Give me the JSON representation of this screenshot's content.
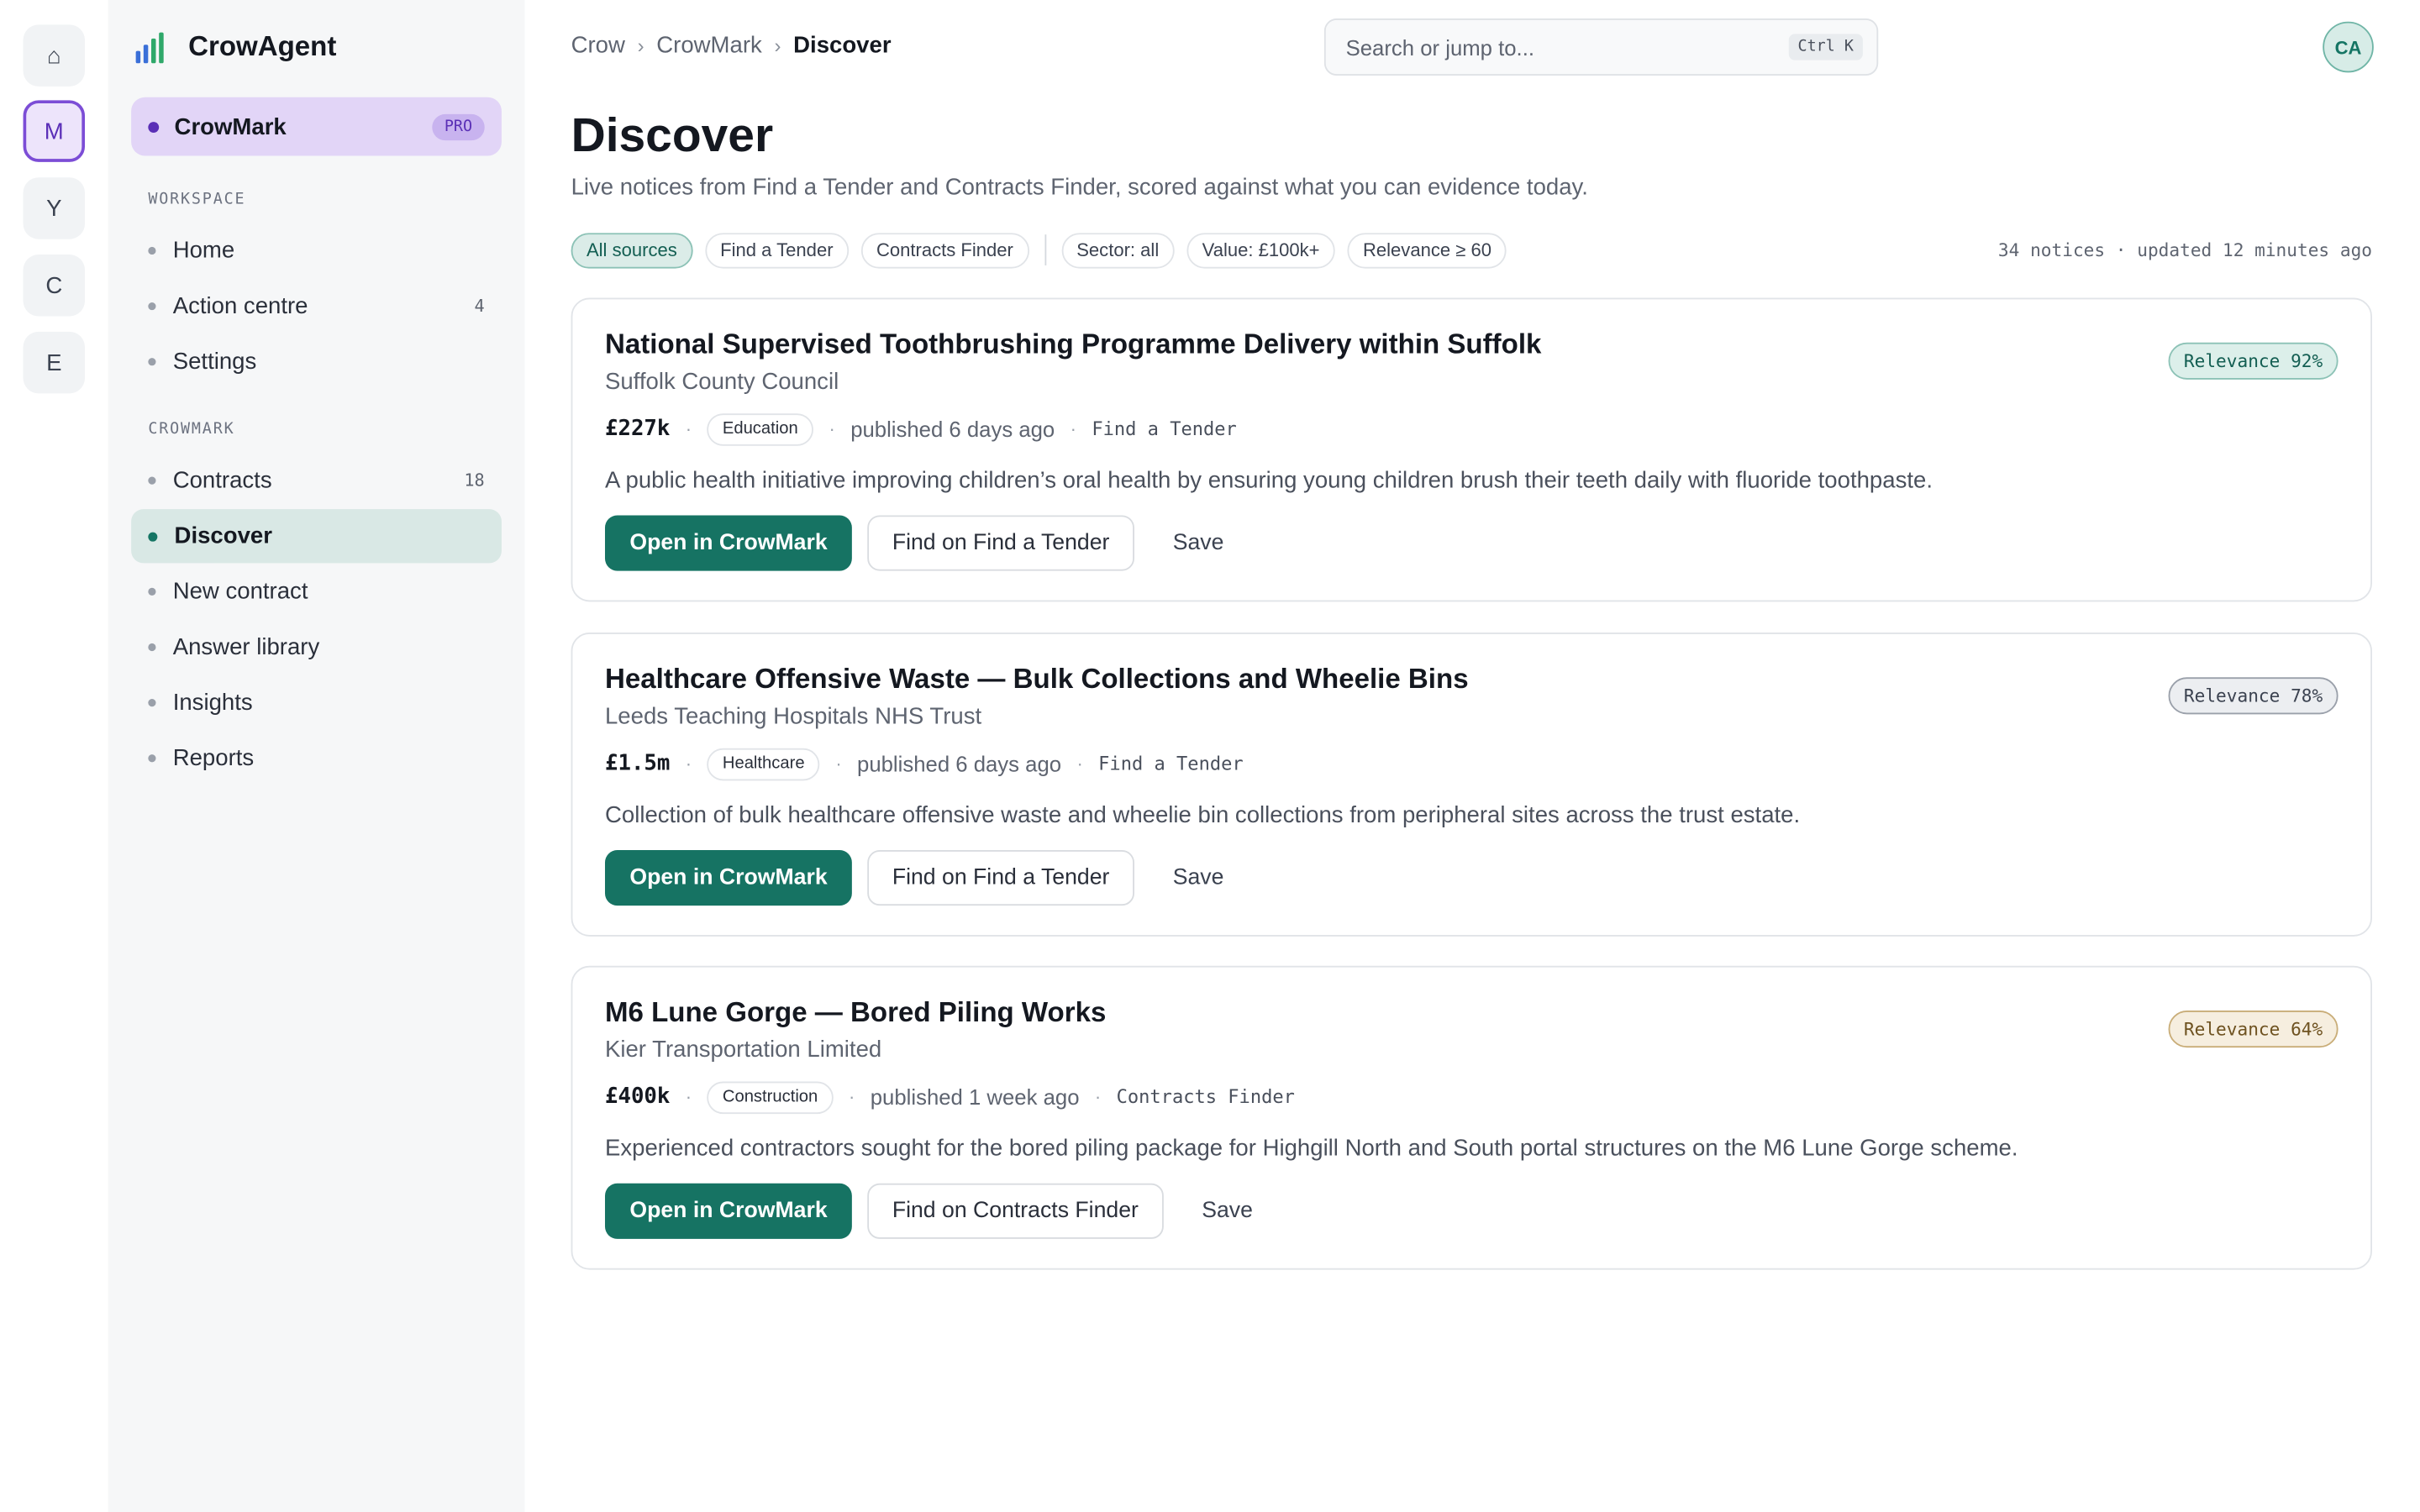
{
  "rail": {
    "items": [
      {
        "label": "⌂",
        "icon": "home-icon"
      },
      {
        "label": "M"
      },
      {
        "label": "Y"
      },
      {
        "label": "C"
      },
      {
        "label": "E"
      }
    ]
  },
  "sidebar": {
    "brand": "CrowAgent",
    "product": {
      "name": "CrowMark",
      "badge": "PRO"
    },
    "workspace_label": "WORKSPACE",
    "workspace_items": [
      {
        "label": "Home",
        "count": ""
      },
      {
        "label": "Action centre",
        "count": "4"
      },
      {
        "label": "Settings",
        "count": ""
      }
    ],
    "crowmark_label": "CROWMARK",
    "crowmark_items": [
      {
        "label": "Contracts",
        "count": "18"
      },
      {
        "label": "Discover",
        "count": ""
      },
      {
        "label": "New contract",
        "count": ""
      },
      {
        "label": "Answer library",
        "count": ""
      },
      {
        "label": "Insights",
        "count": ""
      },
      {
        "label": "Reports",
        "count": ""
      }
    ]
  },
  "header": {
    "breadcrumb": [
      "Crow",
      "CrowMark",
      "Discover"
    ],
    "search_placeholder": "Search or jump to...",
    "search_shortcut": "Ctrl K",
    "avatar": "CA"
  },
  "main": {
    "title": "Discover",
    "subtitle": "Live notices from Find a Tender and Contracts Finder, scored against what you can evidence today.",
    "filters": [
      "All sources",
      "Find a Tender",
      "Contracts Finder"
    ],
    "facets": [
      "Sector: all",
      "Value: £100k+",
      "Relevance ≥ 60"
    ],
    "summary": "34 notices · updated 12 minutes ago"
  },
  "notices": [
    {
      "title": "National Supervised Toothbrushing Programme Delivery within Suffolk",
      "buyer": "Suffolk County Council",
      "relevance": "Relevance 92%",
      "value": "£227k",
      "sector": "Education",
      "published": "published 6 days ago",
      "source": "Find a Tender",
      "description": "A public health initiative improving children’s oral health by ensuring young children brush their teeth daily with fluoride toothpaste.",
      "primary": "Open in CrowMark",
      "secondary": "Find on Find a Tender",
      "save": "Save"
    },
    {
      "title": "Healthcare Offensive Waste — Bulk Collections and Wheelie Bins",
      "buyer": "Leeds Teaching Hospitals NHS Trust",
      "relevance": "Relevance 78%",
      "value": "£1.5m",
      "sector": "Healthcare",
      "published": "published 6 days ago",
      "source": "Find a Tender",
      "description": "Collection of bulk healthcare offensive waste and wheelie bin collections from peripheral sites across the trust estate.",
      "primary": "Open in CrowMark",
      "secondary": "Find on Find a Tender",
      "save": "Save"
    },
    {
      "title": "M6 Lune Gorge — Bored Piling Works",
      "buyer": "Kier Transportation Limited",
      "relevance": "Relevance 64%",
      "value": "£400k",
      "sector": "Construction",
      "published": "published 1 week ago",
      "source": "Contracts Finder",
      "description": "Experienced contractors sought for the bored piling package for Highgill North and South portal structures on the M6 Lune Gorge scheme.",
      "primary": "Open in CrowMark",
      "secondary": "Find on Contracts Finder",
      "save": "Save"
    }
  ],
  "colors": {
    "accent": "#167363",
    "brand_purple": "#5a2fb6",
    "relevance_high": "#157564",
    "relevance_mid": "#4a505c",
    "relevance_low": "#8a6a2a"
  }
}
